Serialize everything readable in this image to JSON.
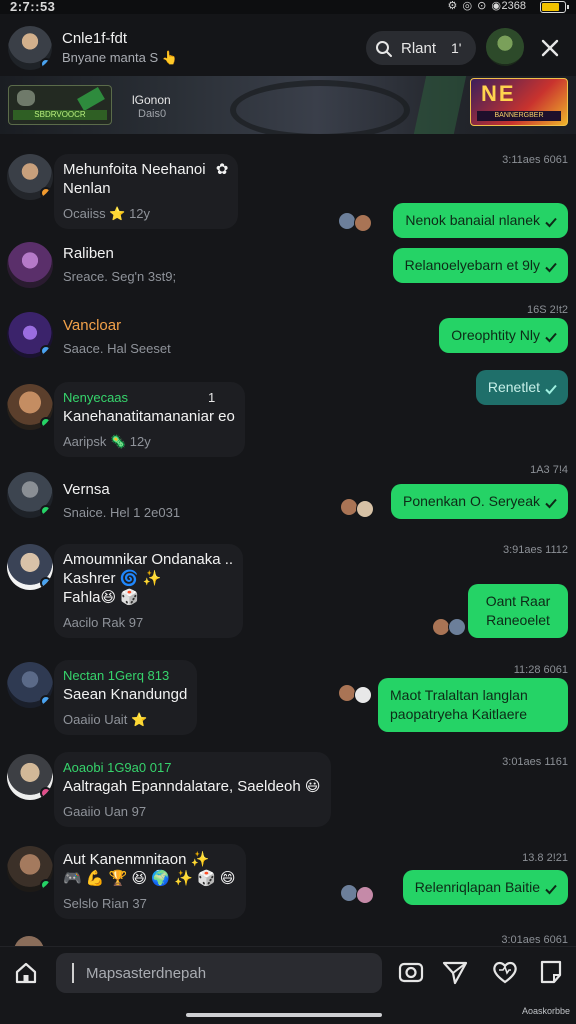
{
  "status_bar": {
    "time": "2:7::53",
    "sys_icons": "⚙ ◎ ⊙ ◉",
    "network": "2368",
    "battery_pct": 75
  },
  "header": {
    "name": "Cnle1f-fdt",
    "subtitle": "Bnyane manta S",
    "subtitle_emoji": "👆",
    "search_label": "Rlant",
    "search_count": "1'"
  },
  "banner": {
    "thumb_label": "SBDRVOOCR",
    "text_line1": "lGonon",
    "text_line2": "Dais0",
    "logo_big": "NE",
    "logo_small": "BANNERGBER"
  },
  "chats": [
    {
      "title": "Mehunfoita Neehanoi",
      "line2": "Nenlan",
      "meta": "Ocaiiss",
      "meta_emoji": "⭐",
      "meta_tail": "12y",
      "timestamp": "3:11aes 6061",
      "outgoing": "Nenok banaial nlanek",
      "avatar_color": "#8a6d5a",
      "dot_color": "#f29a2e"
    },
    {
      "title": "Raliben",
      "meta": "Sreace. Seg'n 3st9;",
      "outgoing": "Relanoelyebarn et 9ly",
      "avatar_color": "#6a3a7a",
      "dot_color": ""
    },
    {
      "title": "Vancloar",
      "meta": "Saace. Hal Seeset",
      "timestamp": "16S 2!t2",
      "outgoing": "Oreophtity Nly",
      "avatar_color": "#4a2a7a",
      "dot_color": "#4aa3f0"
    },
    {
      "title": "Nenyecaas",
      "title_tail": "1",
      "line2": "Kanehanatitamananiar eo",
      "meta": "Aaripsk",
      "meta_emoji": "🦠",
      "meta_tail": "12y",
      "outgoing_dark": "Renetlet",
      "avatar_color": "#b8835a",
      "dot_color": "#25d366"
    },
    {
      "title": "Vernsa",
      "meta": "Snaice. Hel 1 2e031",
      "timestamp": "1A3 7!4",
      "outgoing": "Ponenkan O. Seryeak",
      "avatar_color": "#3d4550",
      "dot_color": "#25d366"
    },
    {
      "title": "Amoumnikar Ondanaka",
      "title_tail": "..",
      "line2": "Kashrer",
      "line2_emoji": "🌀 ✨",
      "line3": "Fahla",
      "line3_emoji": "😆 🎲",
      "meta": "Aacilo Rak",
      "meta_tail": "97",
      "timestamp": "3:91aes 1112",
      "outgoing_multi": [
        "Oant Raar",
        "Raneoelet"
      ],
      "avatar_color": "#d9c2a8",
      "dot_color": "#4aa3f0"
    },
    {
      "title": "Nectan 1Gerq 813",
      "line2": "Saean Knandungd",
      "meta": "Oaaiio Uait",
      "meta_emoji": "⭐",
      "timestamp": "11:28 6061",
      "outgoing_multi": [
        "Maot Tralaltan langlan",
        "paopatryeha Kaitlaere"
      ],
      "avatar_color": "#3b4a66",
      "dot_color": "#4aa3f0"
    },
    {
      "title": "Aoaobi 1G9a0 017",
      "line2": "Aaltragah Epanndalatare, Saeldeoh",
      "line2_emoji": "😃",
      "meta": "Gaaiio Uan",
      "meta_tail": "97",
      "timestamp": "3:01aes 1161",
      "avatar_color": "#cbb9a4",
      "dot_color": "#e04f8a"
    },
    {
      "title": "Aut Kanenmnitaon",
      "title_emoji": "✨",
      "line2_emoji": "🎮 💪 🏆 😆 🌍 ✨ 🎲 😄",
      "meta": "Selslo Rian",
      "meta_tail": "37",
      "timestamp": "13.8 2!21",
      "outgoing": "Relenriqlapan Baitie",
      "avatar_color": "#8d6a55",
      "dot_color": "#25d366"
    }
  ],
  "last_timestamp": "3:01aes 6061",
  "composer": {
    "placeholder": "Mapsasterdnepah"
  },
  "watermark": "Aoaskorbbe"
}
